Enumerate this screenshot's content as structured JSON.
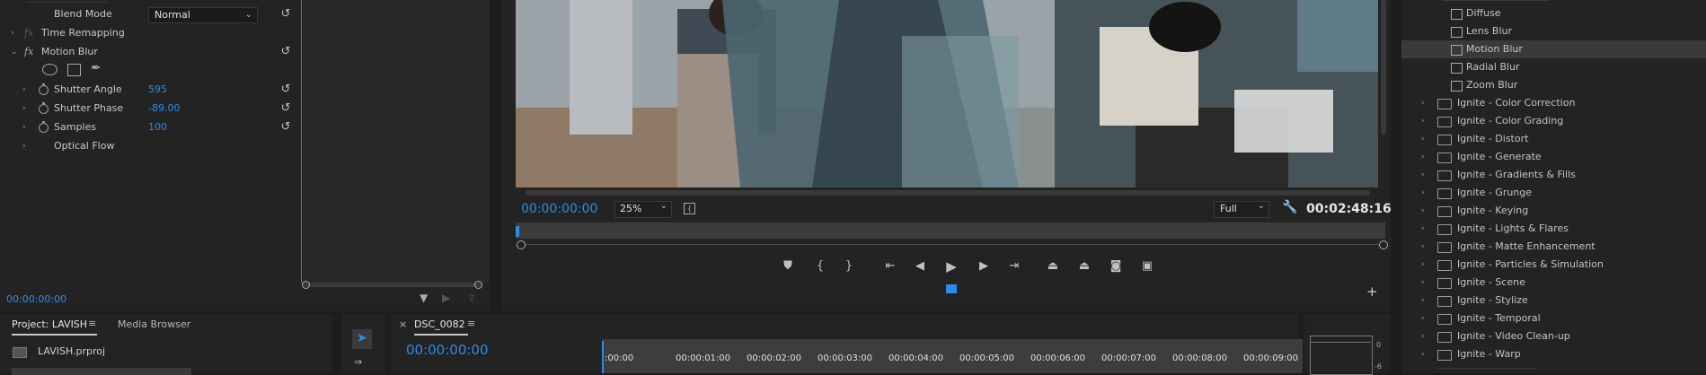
{
  "effect_controls": {
    "blend_mode_label": "Blend Mode",
    "blend_mode_value": "Normal",
    "time_remapping": "Time Remapping",
    "motion_blur": "Motion Blur",
    "fx_label": "fx",
    "shutter_angle_label": "Shutter Angle",
    "shutter_angle_value": "595",
    "shutter_phase_label": "Shutter Phase",
    "shutter_phase_value": "-89.00",
    "samples_label": "Samples",
    "samples_value": "100",
    "optical_flow": "Optical Flow",
    "timecode": "00:00:00:00"
  },
  "program_monitor": {
    "timecode": "00:00:00:00",
    "zoom": "25%",
    "resolution": "Full",
    "duration": "00:02:48:16"
  },
  "effects_panel": {
    "items": [
      {
        "label": "Diffuse",
        "type": "effect",
        "selected": false
      },
      {
        "label": "Lens Blur",
        "type": "effect",
        "selected": false
      },
      {
        "label": "Motion Blur",
        "type": "effect",
        "selected": true
      },
      {
        "label": "Radial Blur",
        "type": "effect",
        "selected": false
      },
      {
        "label": "Zoom Blur",
        "type": "effect",
        "selected": false
      },
      {
        "label": "Ignite - Color Correction",
        "type": "folder"
      },
      {
        "label": "Ignite - Color Grading",
        "type": "folder"
      },
      {
        "label": "Ignite - Distort",
        "type": "folder"
      },
      {
        "label": "Ignite - Generate",
        "type": "folder"
      },
      {
        "label": "Ignite - Gradients & Fills",
        "type": "folder"
      },
      {
        "label": "Ignite - Grunge",
        "type": "folder"
      },
      {
        "label": "Ignite - Keying",
        "type": "folder"
      },
      {
        "label": "Ignite - Lights & Flares",
        "type": "folder"
      },
      {
        "label": "Ignite - Matte Enhancement",
        "type": "folder"
      },
      {
        "label": "Ignite - Particles & Simulation",
        "type": "folder"
      },
      {
        "label": "Ignite - Scene",
        "type": "folder"
      },
      {
        "label": "Ignite - Stylize",
        "type": "folder"
      },
      {
        "label": "Ignite - Temporal",
        "type": "folder"
      },
      {
        "label": "Ignite - Video Clean-up",
        "type": "folder"
      },
      {
        "label": "Ignite - Warp",
        "type": "folder"
      }
    ]
  },
  "project_panel": {
    "tab_project": "Project: LAVISH",
    "tab_media_browser": "Media Browser",
    "file": "LAVISH.prproj"
  },
  "timeline": {
    "sequence_name": "DSC_0082",
    "close_glyph": "×",
    "timecode": "00:00:00:00",
    "ruler": [
      ":00:00",
      "00:00:01:00",
      "00:00:02:00",
      "00:00:03:00",
      "00:00:04:00",
      "00:00:05:00",
      "00:00:06:00",
      "00:00:07:00",
      "00:00:08:00",
      "00:00:09:00"
    ]
  },
  "audio_meter": {
    "ticks": [
      "0",
      "-6"
    ]
  },
  "colors": {
    "accent_blue": "#2d8ceb",
    "panel_bg": "#232323",
    "selected_row": "#3a3a3a"
  }
}
